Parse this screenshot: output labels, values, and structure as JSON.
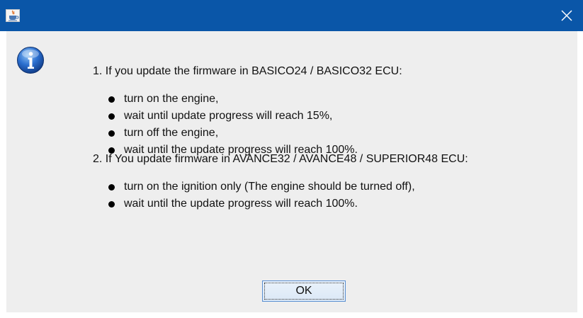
{
  "titlebar": {
    "title": "",
    "app_icon": "java-cup-icon",
    "close_icon": "close-icon",
    "colors": {
      "background": "#0a56a8",
      "close": "#ffffff"
    }
  },
  "dialog": {
    "icon": "info-icon",
    "step1": {
      "heading": "1. If you update the firmware in BASICO24 / BASICO32 ECU:",
      "bullets": [
        "turn on the engine,",
        "wait until update progress will reach 15%,",
        "turn off the engine,",
        "wait until the update progress will reach 100%."
      ]
    },
    "step2": {
      "heading": "2. If You update firmware in AVANCE32 / AVANCE48 / SUPERIOR48 ECU:",
      "bullets": [
        "turn on the ignition only (The engine should be turned off),",
        "wait until the update progress will reach 100%."
      ]
    },
    "ok_label": "OK"
  }
}
